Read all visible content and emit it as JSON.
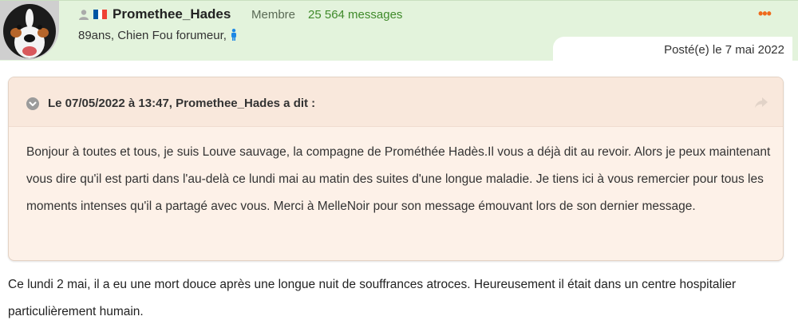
{
  "author": {
    "username": "Promethee_Hades",
    "role": "Membre",
    "message_count": "25 564 messages",
    "subline": "89ans, Chien Fou forumeur,",
    "flag": "France",
    "avatar": "bernese-dog-avatar"
  },
  "menu": {
    "dots": "•••"
  },
  "post": {
    "date": "Posté(e) le 7 mai 2022",
    "body": "Ce lundi 2 mai, il a eu une mort douce après une longue nuit de souffrances atroces. Heureusement il était dans un centre hospitalier particulièrement humain."
  },
  "quote": {
    "title": "Le 07/05/2022 à 13:47, Promethee_Hades a dit :",
    "text": "Bonjour à toutes et tous, je suis Louve sauvage, la compagne de Prométhée Hadès.Il vous a déjà dit au revoir. Alors je peux maintenant vous dire qu'il est parti dans l'au-delà ce lundi  mai au matin des suites d'une longue maladie. Je tiens ici à vous remercier  pour tous les moments intenses qu'il a partagé avec vous. Merci à MelleNoir pour son message émouvant lors de son dernier message."
  },
  "colors": {
    "header_bg": "#e3f3dc",
    "quote_bg": "#fdf1e8",
    "accent_orange": "#ef6a1c",
    "count_green": "#3f8a2a",
    "gender_blue": "#1e88e5"
  }
}
